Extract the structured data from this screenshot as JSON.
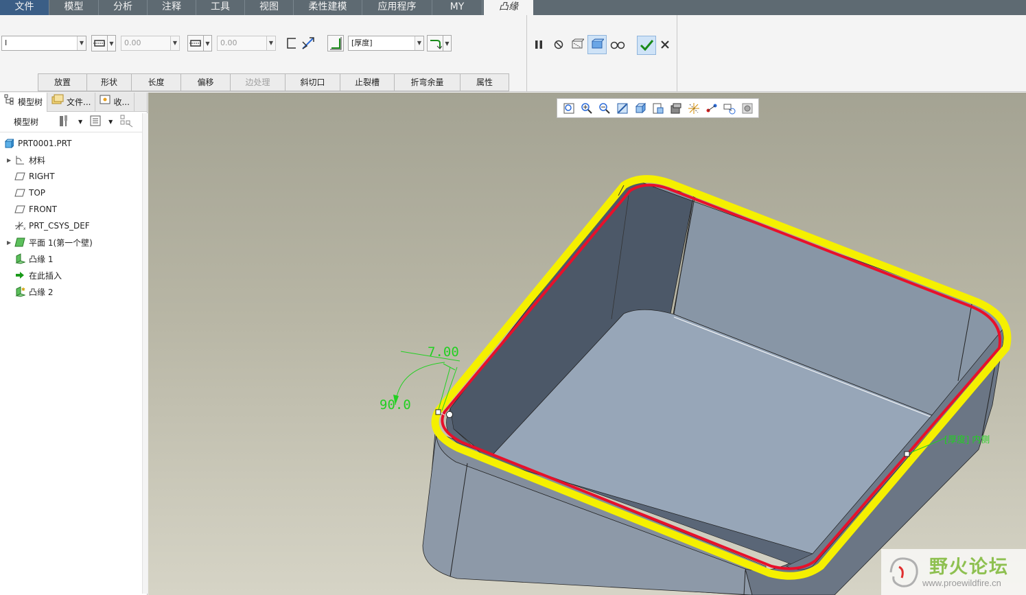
{
  "ribbon": {
    "tabs": [
      "文件",
      "模型",
      "分析",
      "注释",
      "工具",
      "视图",
      "柔性建模",
      "应用程序",
      "MY",
      "凸缘"
    ]
  },
  "dashboard": {
    "type_value": "I",
    "length1_value": "0.00",
    "length2_value": "0.00",
    "thickness_option": "[厚度]",
    "subtabs": [
      "放置",
      "形状",
      "长度",
      "偏移",
      "边处理",
      "斜切口",
      "止裂槽",
      "折弯余量",
      "属性"
    ]
  },
  "left_panel": {
    "tabs": [
      "模型树",
      "文件...",
      "收..."
    ],
    "toolbar_label": "模型树",
    "tree": [
      {
        "label": "PRT0001.PRT",
        "icon": "part-icon",
        "expand": false
      },
      {
        "label": "材料",
        "icon": "material-icon",
        "expand": true
      },
      {
        "label": "RIGHT",
        "icon": "datum-plane-icon",
        "expand": false
      },
      {
        "label": "TOP",
        "icon": "datum-plane-icon",
        "expand": false
      },
      {
        "label": "FRONT",
        "icon": "datum-plane-icon",
        "expand": false
      },
      {
        "label": "PRT_CSYS_DEF",
        "icon": "csys-icon",
        "expand": false
      },
      {
        "label": "平面 1(第一个壁)",
        "icon": "planar-wall-icon",
        "expand": true
      },
      {
        "label": "凸缘 1",
        "icon": "flange-icon",
        "expand": false
      },
      {
        "label": "在此插入",
        "icon": "insert-here-arrow-icon",
        "expand": false
      },
      {
        "label": "凸缘 2",
        "icon": "flange-new-icon",
        "expand": false
      }
    ]
  },
  "viewport": {
    "dim_length": "7.00",
    "dim_angle": "90.0",
    "thickness_label": "[厚度] 内侧"
  },
  "watermark": {
    "title": "野火论坛",
    "url": "www.proewildfire.cn"
  },
  "colors": {
    "tabbar": "#5e6a72",
    "file_tab": "#3b5e86",
    "edge_yellow": "#f5f000",
    "edge_red": "#e8102a",
    "dim_green": "#22d022",
    "confirm_blue": "#6aa6e6"
  }
}
